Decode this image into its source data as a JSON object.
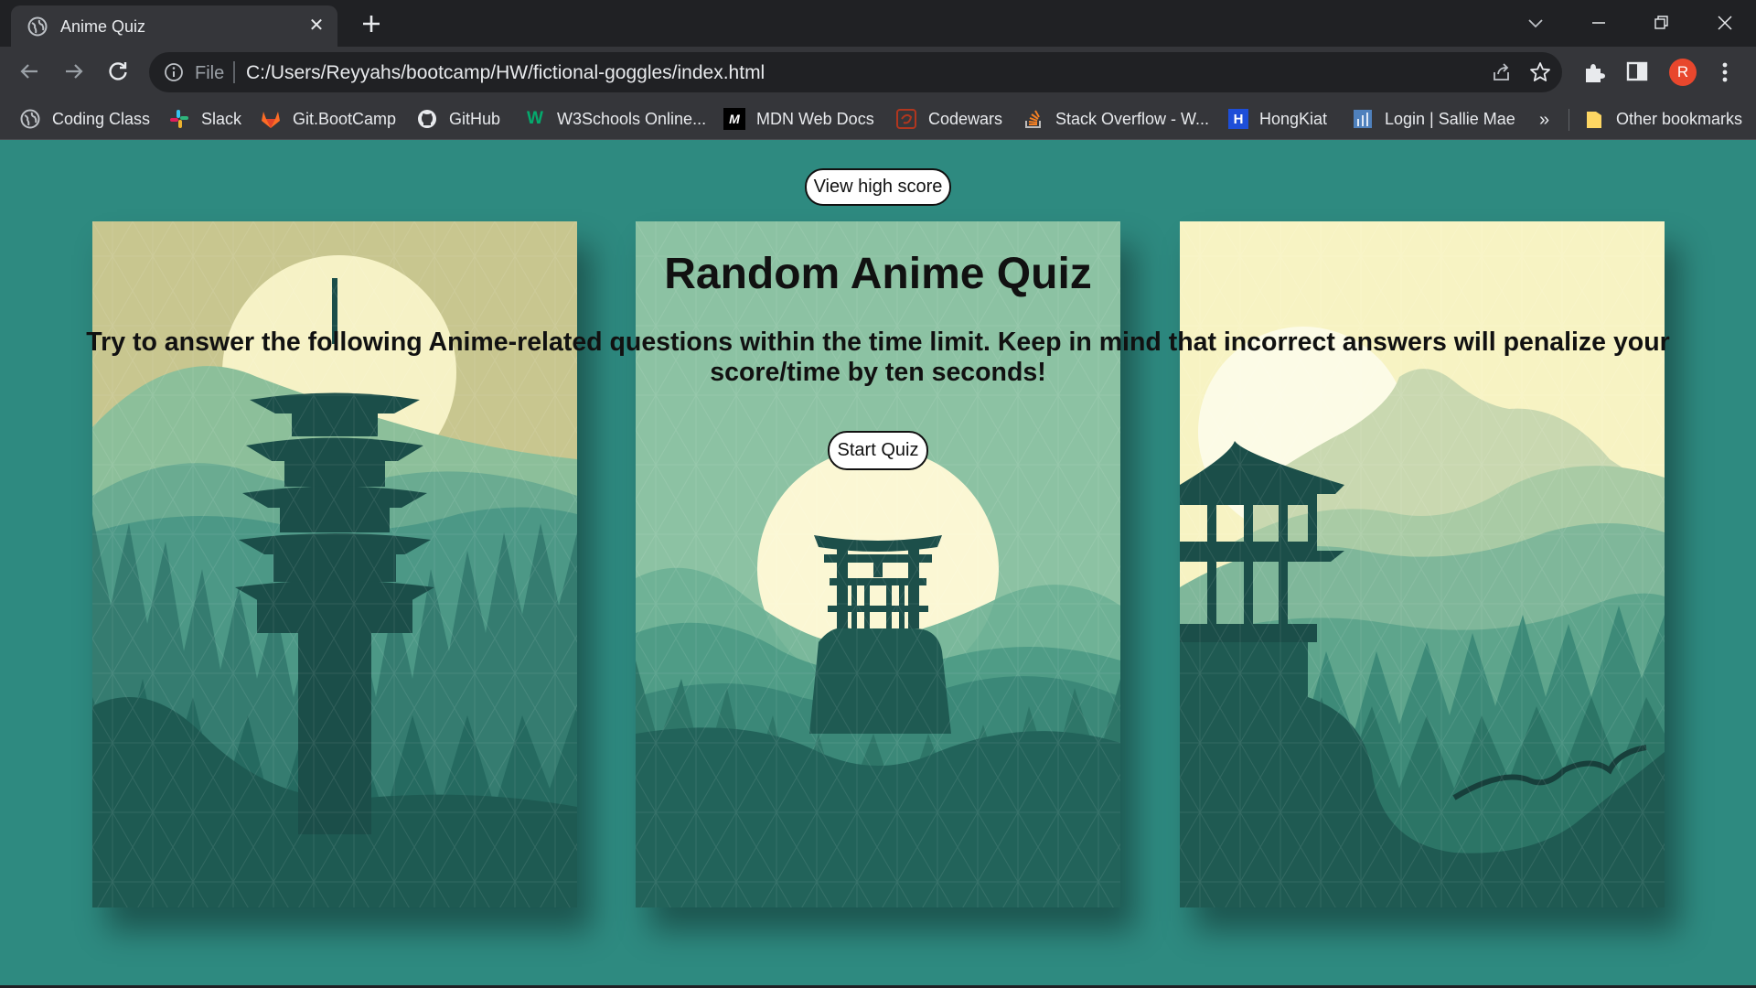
{
  "browser": {
    "tab_title": "Anime Quiz",
    "scheme_label": "File",
    "url": "C:/Users/Reyyahs/bootcamp/HW/fictional-goggles/index.html",
    "profile_initial": "R",
    "bookmarks": [
      {
        "label": "Coding Class",
        "icon": "globe-icon"
      },
      {
        "label": "Slack",
        "icon": "slack-icon"
      },
      {
        "label": "Git.BootCamp",
        "icon": "gitlab-icon"
      },
      {
        "label": "GitHub",
        "icon": "github-icon"
      },
      {
        "label": "W3Schools Online...",
        "icon": "w3schools-icon"
      },
      {
        "label": "MDN Web Docs",
        "icon": "mdn-icon"
      },
      {
        "label": "Codewars",
        "icon": "codewars-icon"
      },
      {
        "label": "Stack Overflow - W...",
        "icon": "stackoverflow-icon"
      },
      {
        "label": "HongKiat",
        "icon": "hongkiat-icon"
      },
      {
        "label": "Login | Sallie Mae",
        "icon": "salliemae-icon"
      }
    ],
    "more_bookmarks": "»",
    "other_bookmarks": "Other bookmarks"
  },
  "page": {
    "high_score_button": "View high score",
    "title": "Random Anime Quiz",
    "description": "Try to answer the following Anime-related questions within the time limit. Keep in mind that incorrect answers will penalize your score/time by ten seconds!",
    "start_button": "Start Quiz"
  },
  "colors": {
    "page_background": "#2e8a80",
    "chrome_dark": "#202124",
    "chrome_toolbar": "#35363a",
    "avatar": "#e8472d"
  }
}
